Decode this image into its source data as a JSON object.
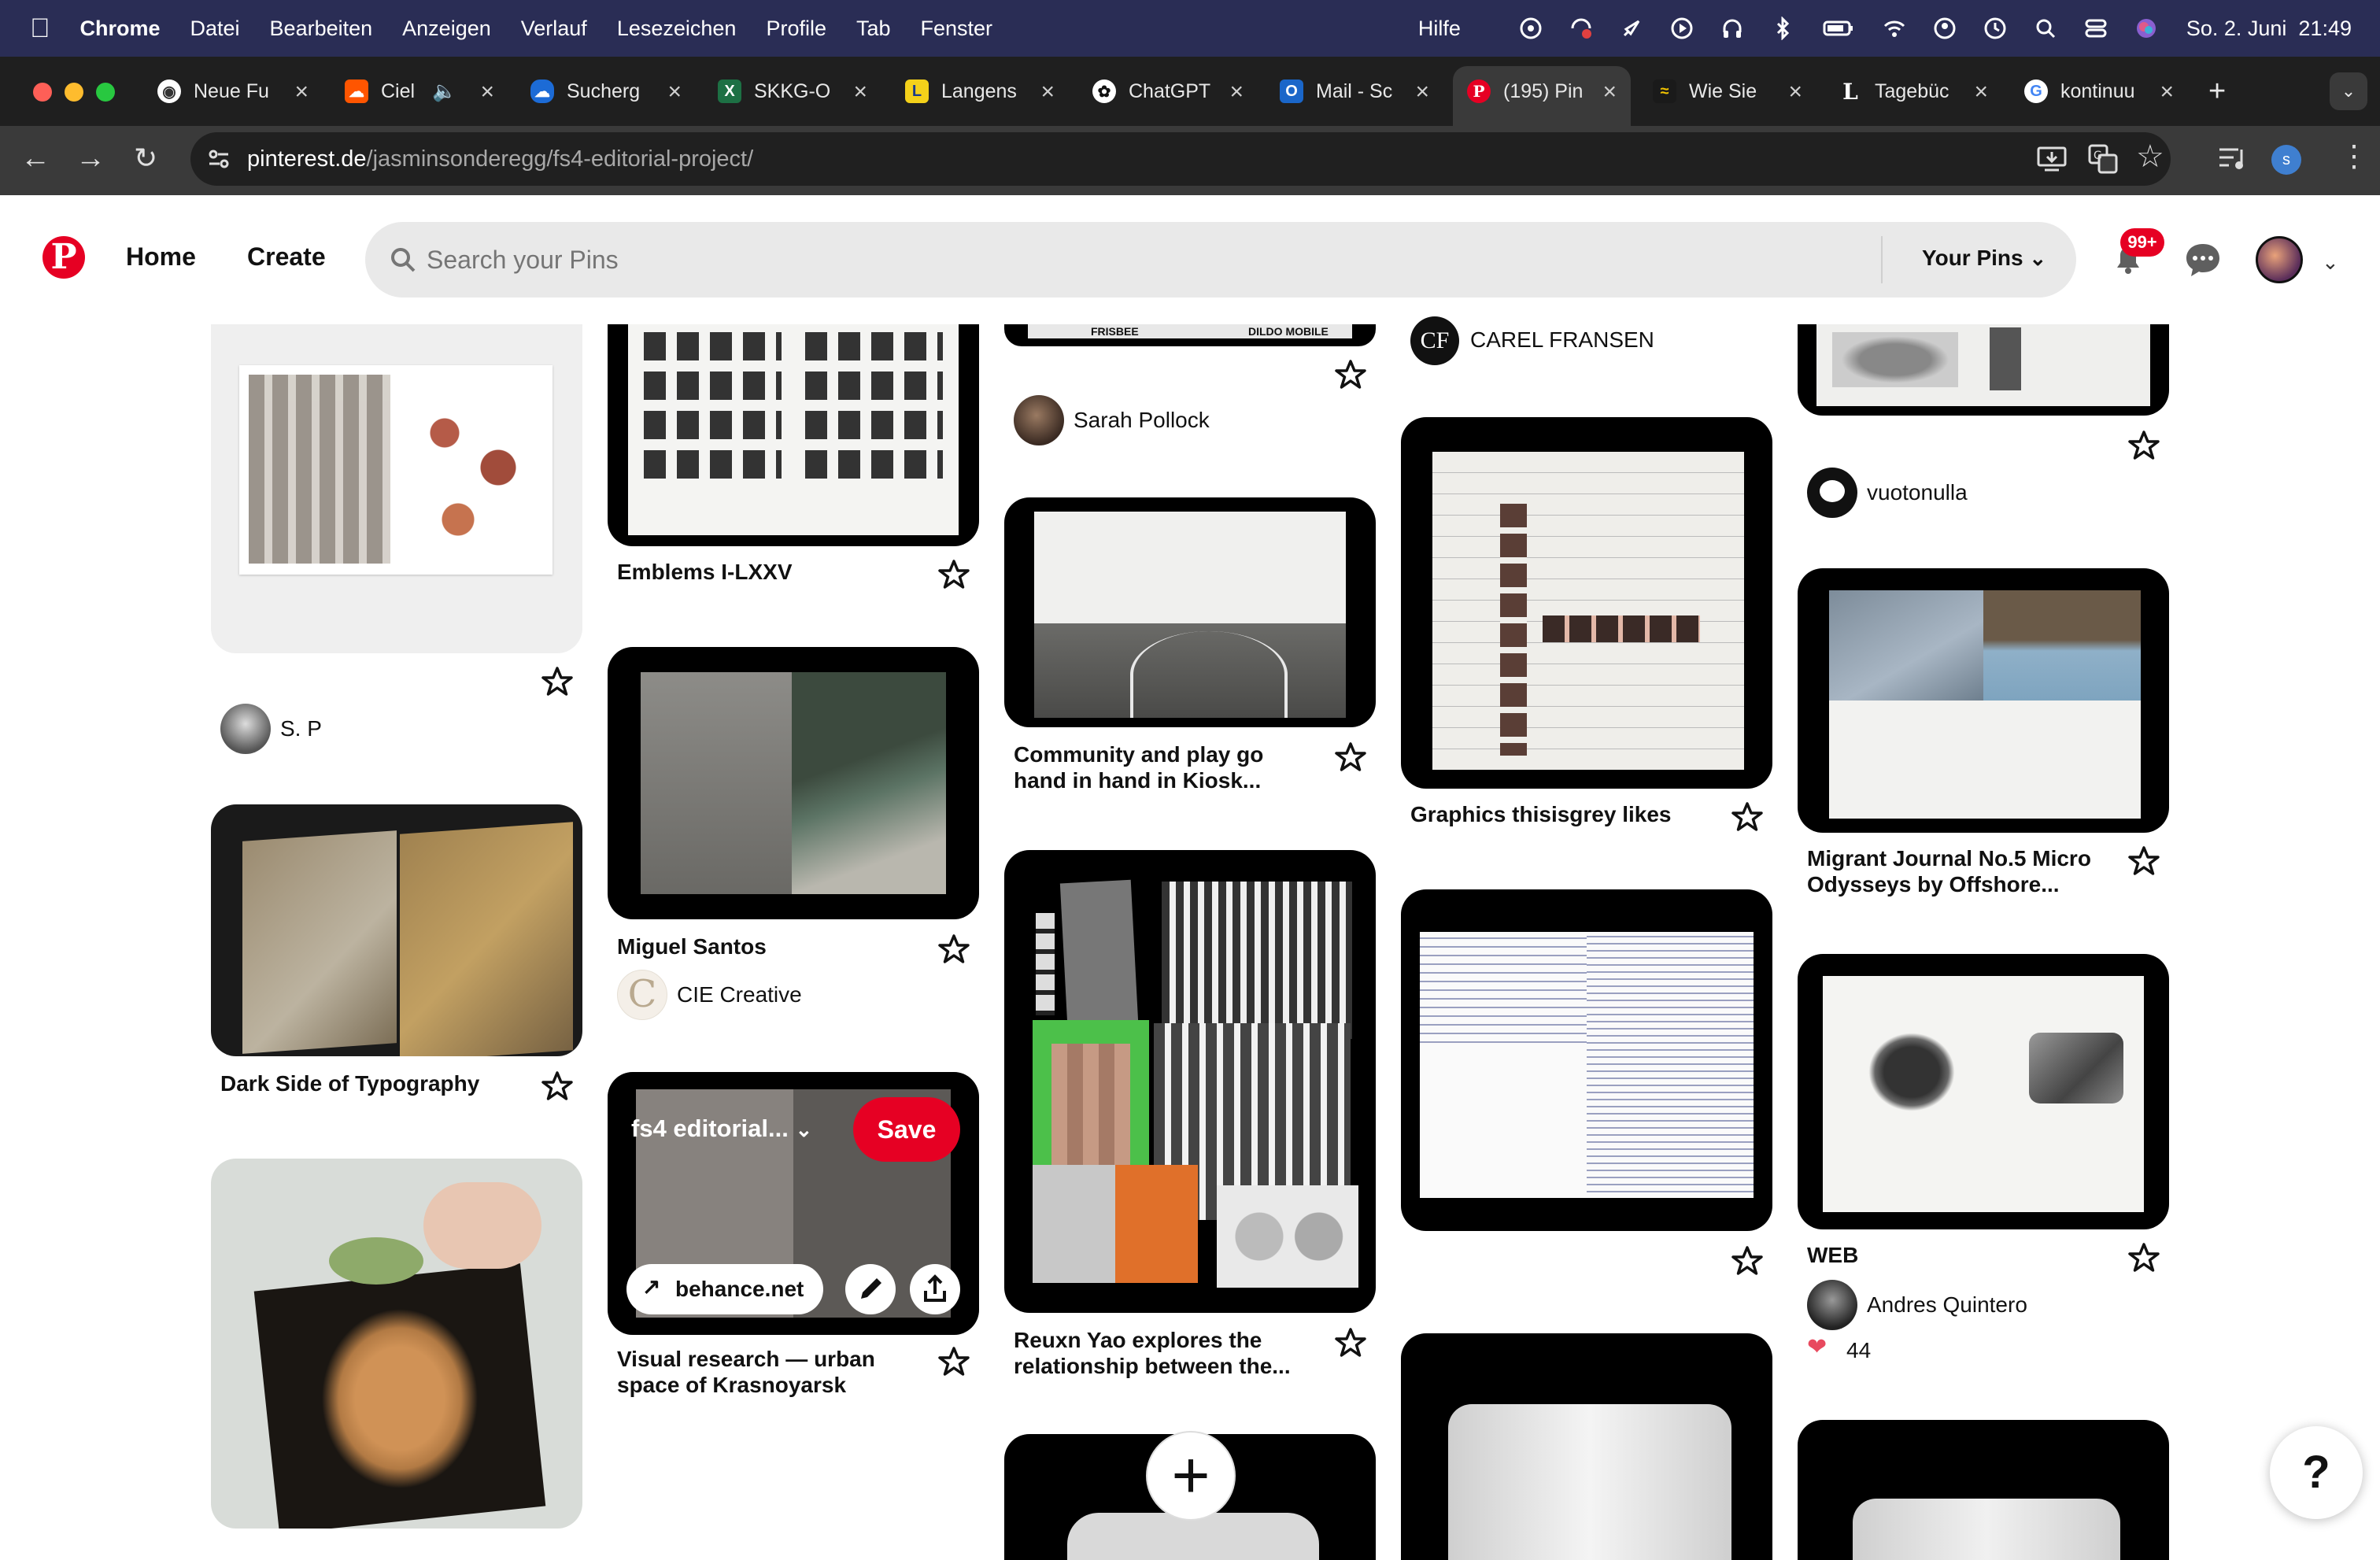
{
  "menubar": {
    "app": "Chrome",
    "items": [
      "Datei",
      "Bearbeiten",
      "Anzeigen",
      "Verlauf",
      "Lesezeichen",
      "Profile",
      "Tab",
      "Fenster"
    ],
    "help": "Hilfe",
    "clock": "So. 2. Juni  21:49"
  },
  "tabs": [
    {
      "label": "Neue Fu",
      "icon": "chrome-icon"
    },
    {
      "label": "Ciel",
      "icon": "soundcloud-icon"
    },
    {
      "label": "Sucherg",
      "icon": "onedrive-icon"
    },
    {
      "label": "SKKG-O",
      "icon": "excel-icon"
    },
    {
      "label": "Langens",
      "icon": "langenscheidt-icon"
    },
    {
      "label": "ChatGPT",
      "icon": "chatgpt-icon"
    },
    {
      "label": "Mail - Sc",
      "icon": "outlook-icon"
    },
    {
      "label": "(195) Pin",
      "icon": "pinterest-icon"
    },
    {
      "label": "Wie Sie",
      "icon": "wave-icon"
    },
    {
      "label": "Tagebüc",
      "icon": "l-icon"
    },
    {
      "label": "kontinuu",
      "icon": "google-icon"
    }
  ],
  "address": {
    "domain": "pinterest.de",
    "path": "/jasminsonderegg/fs4-editorial-project/"
  },
  "header": {
    "home": "Home",
    "create": "Create",
    "search_placeholder": "Search your Pins",
    "your_pins": "Your Pins",
    "notif_badge": "99+"
  },
  "pins": {
    "c1_creator": "S. P",
    "c1_title2": "Dark Side of Typography",
    "c2_title1": "Emblems I-LXXV",
    "c2_title2": "Miguel Santos",
    "c2_creator2": "CIE Creative",
    "c2_board": "fs4 editorial...",
    "c2_save": "Save",
    "c2_link": "behance.net",
    "c2_title3a": "Visual research — urban",
    "c2_title3b": "space of Krasnoyarsk",
    "c3_cover_text_a": "FRISBEE",
    "c3_cover_text_b": "DILDO MOBILE",
    "c3_creator1": "Sarah Pollock",
    "c3_title2a": "Community and play go",
    "c3_title2b": "hand in hand in Kiosk...",
    "c3_title3a": "Reuxn Yao explores the",
    "c3_title3b": "relationship between the...",
    "c4_creator_initials": "CF",
    "c4_creator1": "CAREL FRANSEN",
    "c4_title2": "Graphics thisisgrey likes",
    "c5_creator1": "vuotonulla",
    "c5_title2a": "Migrant Journal No.5 Micro",
    "c5_title2b": "Odysseys by Offshore...",
    "c5_title3": "WEB",
    "c5_creator3": "Andres Quintero",
    "c5_likes": "44"
  },
  "help_label": "?",
  "colors": {
    "pinterest_red": "#e60023",
    "menubar": "#2a2d55",
    "chrome_dark": "#1f1f1f"
  }
}
